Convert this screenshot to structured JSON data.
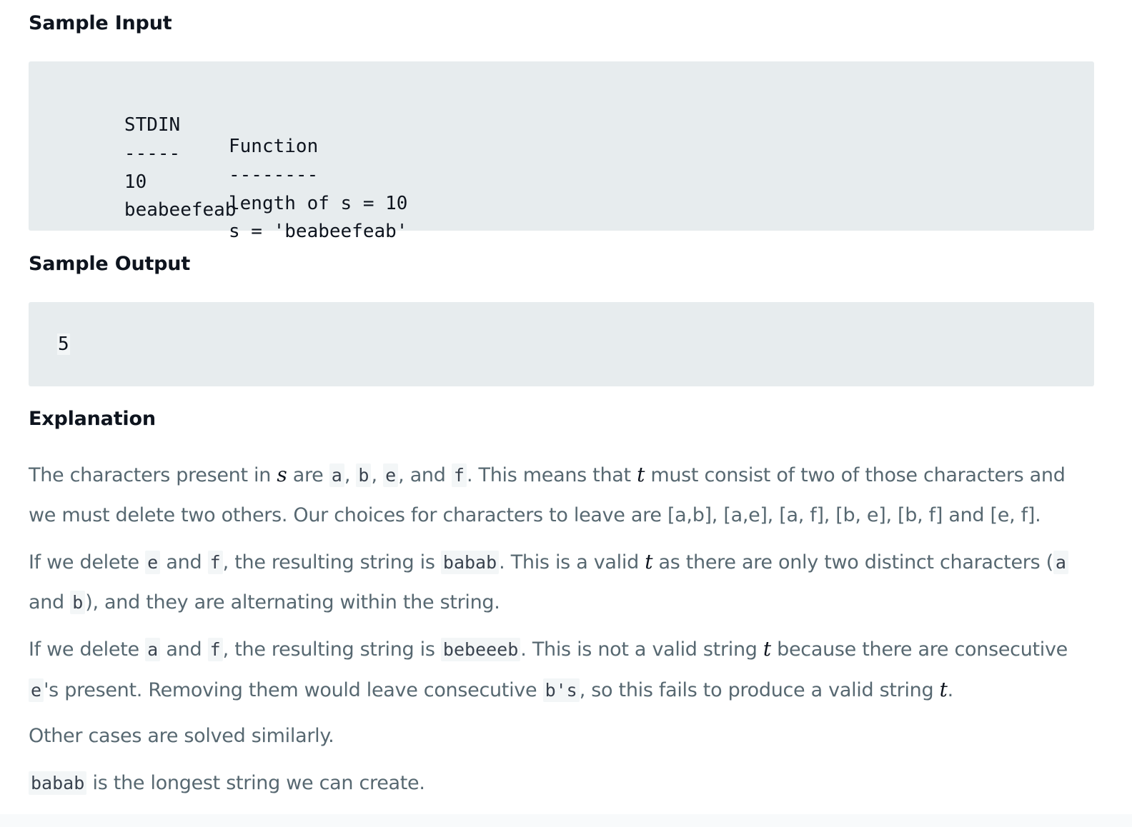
{
  "headings": {
    "sample_input": "Sample Input",
    "sample_output": "Sample Output",
    "explanation": "Explanation"
  },
  "sample_input": {
    "header": [
      "STDIN",
      "Function"
    ],
    "divider": [
      "-----",
      "--------"
    ],
    "rows": [
      [
        "10",
        "length of s = 10"
      ],
      [
        "beabeefeab",
        "s = 'beabeefeab'"
      ]
    ]
  },
  "sample_output": {
    "value": "5"
  },
  "explanation": {
    "p1": {
      "t1": "The characters present in ",
      "m1": "s",
      "t2": " are ",
      "c1": "a",
      "t3": ", ",
      "c2": "b",
      "t4": ", ",
      "c3": "e",
      "t5": ", and ",
      "c4": "f",
      "t6": ". This means that ",
      "m2": "t",
      "t7": " must consist of two of those characters and we must delete two others. Our choices for characters to leave are [a,b], [a,e], [a, f], [b, e], [b, f] and [e, f]."
    },
    "p2": {
      "t1": "If we delete ",
      "c1": "e",
      "t2": " and ",
      "c2": "f",
      "t3": ", the resulting string is ",
      "c3": "babab",
      "t4": ". This is a valid ",
      "m1": "t",
      "t5": " as there are only two distinct characters (",
      "c4": "a",
      "t6": " and ",
      "c5": "b",
      "t7": "), and they are alternating within the string."
    },
    "p3": {
      "t1": "If we delete ",
      "c1": "a",
      "t2": " and ",
      "c2": "f",
      "t3": ", the resulting string is ",
      "c3": "bebeeeb",
      "t4": ". This is not a valid string ",
      "m1": "t",
      "t5": " because there are consecutive ",
      "c4": "e",
      "t6": "'s present. Removing them would leave consecutive ",
      "c5": "b's",
      "t7": ", so this fails to produce a valid string ",
      "m2": "t",
      "t8": "."
    },
    "p4": {
      "t1": "Other cases are solved similarly."
    },
    "p5": {
      "c1": "babab",
      "t1": " is the longest string we can create."
    }
  }
}
